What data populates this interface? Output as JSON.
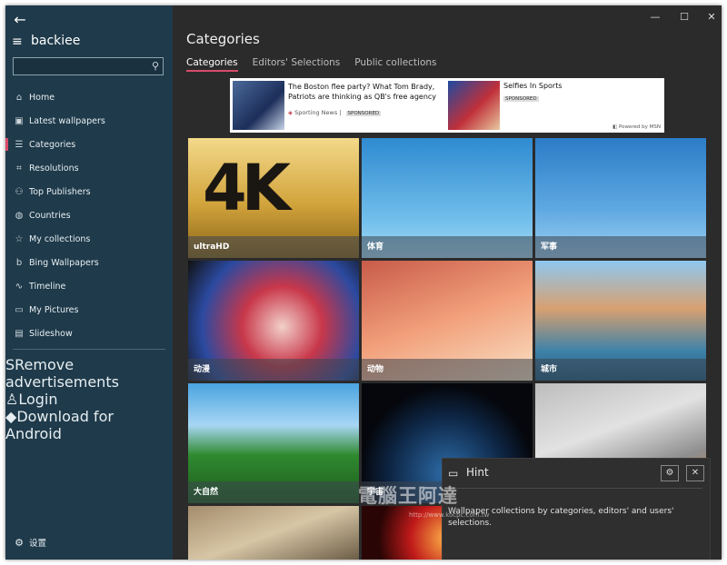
{
  "sidebar": {
    "brand": "backiee",
    "search": {
      "value": "",
      "placeholder": ""
    },
    "items": [
      {
        "label": "Home",
        "icon": "home-icon",
        "glyph": "⌂"
      },
      {
        "label": "Latest wallpapers",
        "icon": "image-icon",
        "glyph": "▣"
      },
      {
        "label": "Categories",
        "icon": "list-icon",
        "glyph": "☰",
        "active": true
      },
      {
        "label": "Resolutions",
        "icon": "resolution-icon",
        "glyph": "⌗"
      },
      {
        "label": "Top Publishers",
        "icon": "people-icon",
        "glyph": "⚇"
      },
      {
        "label": "Countries",
        "icon": "globe-icon",
        "glyph": "◍"
      },
      {
        "label": "My collections",
        "icon": "star-icon",
        "glyph": "☆"
      },
      {
        "label": "Bing Wallpapers",
        "icon": "bing-icon",
        "glyph": "b"
      },
      {
        "label": "Timeline",
        "icon": "timeline-icon",
        "glyph": "∿"
      },
      {
        "label": "My Pictures",
        "icon": "picture-icon",
        "glyph": "▭"
      },
      {
        "label": "Slideshow",
        "icon": "slideshow-icon",
        "glyph": "▤"
      }
    ],
    "items2": [
      {
        "label": "Remove advertisements",
        "icon": "dollar-icon",
        "glyph": "S"
      },
      {
        "label": "Login",
        "icon": "user-icon",
        "glyph": "♙"
      },
      {
        "label": "Download for Android",
        "icon": "android-icon",
        "glyph": "◆"
      }
    ],
    "settings_label": "设置"
  },
  "main": {
    "title": "Categories",
    "tabs": [
      {
        "label": "Categories",
        "active": true
      },
      {
        "label": "Editors' Selections"
      },
      {
        "label": "Public collections"
      }
    ],
    "ad": {
      "headline1": "The Boston flee party? What Tom Brady, Patriots are thinking as QB's free agency",
      "source1": "Sporting News |",
      "sponsored": "SPONSORED",
      "headline2": "Selfies In Sports",
      "powered": "Powered by MSN"
    },
    "tiles": [
      {
        "label": "ultraHD",
        "cls": "t4k"
      },
      {
        "label": "体育",
        "cls": "tsport"
      },
      {
        "label": "军事",
        "cls": "tair"
      },
      {
        "label": "动漫",
        "cls": "tanime"
      },
      {
        "label": "动物",
        "cls": "tbird"
      },
      {
        "label": "城市",
        "cls": "tcity"
      },
      {
        "label": "大自然",
        "cls": "tnature"
      },
      {
        "label": "宇宙",
        "cls": "tspace"
      },
      {
        "label": "",
        "cls": "tmech"
      },
      {
        "label": "",
        "cls": "tcat"
      },
      {
        "label": "",
        "cls": "tfire"
      },
      {
        "label": "",
        "cls": "tgreen"
      }
    ],
    "tile_4k_text": "4K"
  },
  "hint": {
    "title": "Hint",
    "text": "Wallpaper collections by categories, editors' and users' selections."
  },
  "watermark": {
    "text": "電腦王阿達",
    "url": "http://www.kocpc.com.tw"
  }
}
